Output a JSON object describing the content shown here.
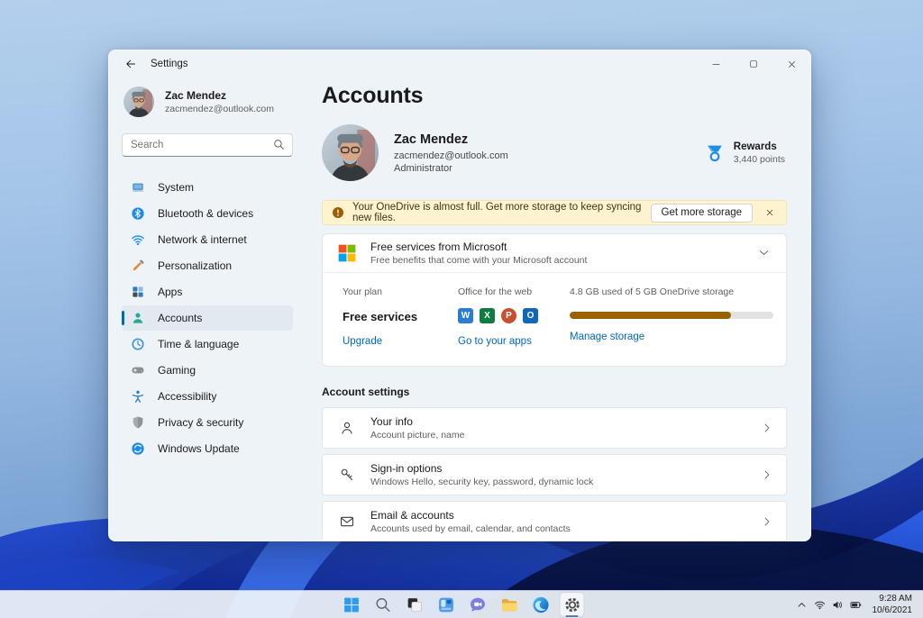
{
  "window": {
    "title": "Settings",
    "controls": {
      "minimize": "minimize",
      "maximize": "maximize",
      "close": "close"
    }
  },
  "sidebar": {
    "user": {
      "name": "Zac Mendez",
      "email": "zacmendez@outlook.com"
    },
    "search": {
      "placeholder": "Search"
    },
    "items": [
      {
        "label": "System",
        "icon": "monitor-icon",
        "selected": false
      },
      {
        "label": "Bluetooth & devices",
        "icon": "bluetooth-icon",
        "selected": false
      },
      {
        "label": "Network & internet",
        "icon": "wifi-icon",
        "selected": false
      },
      {
        "label": "Personalization",
        "icon": "brush-icon",
        "selected": false
      },
      {
        "label": "Apps",
        "icon": "apps-icon",
        "selected": false
      },
      {
        "label": "Accounts",
        "icon": "person-icon",
        "selected": true
      },
      {
        "label": "Time & language",
        "icon": "clock-icon",
        "selected": false
      },
      {
        "label": "Gaming",
        "icon": "gamepad-icon",
        "selected": false
      },
      {
        "label": "Accessibility",
        "icon": "accessibility-icon",
        "selected": false
      },
      {
        "label": "Privacy & security",
        "icon": "shield-icon",
        "selected": false
      },
      {
        "label": "Windows Update",
        "icon": "update-icon",
        "selected": false
      }
    ]
  },
  "main": {
    "title": "Accounts",
    "profile": {
      "name": "Zac Mendez",
      "email": "zacmendez@outlook.com",
      "role": "Administrator"
    },
    "rewards": {
      "label": "Rewards",
      "points": "3,440 points"
    },
    "banner": {
      "text": "Your OneDrive is almost full. Get more storage to keep syncing new files.",
      "button_label": "Get more storage"
    },
    "free_services": {
      "title": "Free services from Microsoft",
      "subtitle": "Free benefits that come with your Microsoft account",
      "plan": {
        "label": "Your plan",
        "value": "Free services",
        "link": "Upgrade"
      },
      "office": {
        "label": "Office for the web",
        "apps": [
          {
            "name": "word",
            "letter": "W",
            "color": "#2b7cd3",
            "shape": "square"
          },
          {
            "name": "excel",
            "letter": "X",
            "color": "#107c41",
            "shape": "square"
          },
          {
            "name": "powerpoint",
            "letter": "P",
            "color": "#c94f31",
            "shape": "round"
          },
          {
            "name": "outlook",
            "letter": "O",
            "color": "#1066b8",
            "shape": "square"
          }
        ],
        "link": "Go to your apps"
      },
      "storage": {
        "label": "4.8 GB used of 5 GB OneDrive storage",
        "fill_percent": 79,
        "link": "Manage storage"
      }
    },
    "account_settings": {
      "heading": "Account settings",
      "rows": [
        {
          "title": "Your info",
          "subtitle": "Account picture, name",
          "icon": "person-outline-icon"
        },
        {
          "title": "Sign-in options",
          "subtitle": "Windows Hello, security key, password, dynamic lock",
          "icon": "key-icon"
        },
        {
          "title": "Email & accounts",
          "subtitle": "Accounts used by email, calendar, and contacts",
          "icon": "mail-icon"
        }
      ]
    }
  },
  "taskbar": {
    "icons": [
      {
        "name": "start",
        "icon": "start-icon",
        "active": false
      },
      {
        "name": "search",
        "icon": "search-icon",
        "active": false
      },
      {
        "name": "task-view",
        "icon": "taskview-icon",
        "active": false
      },
      {
        "name": "widgets",
        "icon": "widgets-icon",
        "active": false
      },
      {
        "name": "chat",
        "icon": "chat-icon",
        "active": false
      },
      {
        "name": "file-explorer",
        "icon": "folder-icon",
        "active": false
      },
      {
        "name": "edge",
        "icon": "edge-icon",
        "active": false
      },
      {
        "name": "settings",
        "icon": "gear-icon",
        "active": true
      }
    ],
    "tray": {
      "icons": [
        {
          "name": "hidden-icons",
          "icon": "chevron-up-icon"
        },
        {
          "name": "network",
          "icon": "wifi-tray-icon"
        },
        {
          "name": "volume",
          "icon": "volume-icon"
        },
        {
          "name": "battery",
          "icon": "battery-icon"
        }
      ],
      "time": "9:28 AM",
      "date": "10/6/2021"
    }
  },
  "colors": {
    "accent": "#0067c0",
    "banner_bg": "#fdf3cf",
    "progress_fill": "#9d6000",
    "selection_bg": "#e3e9f0"
  }
}
